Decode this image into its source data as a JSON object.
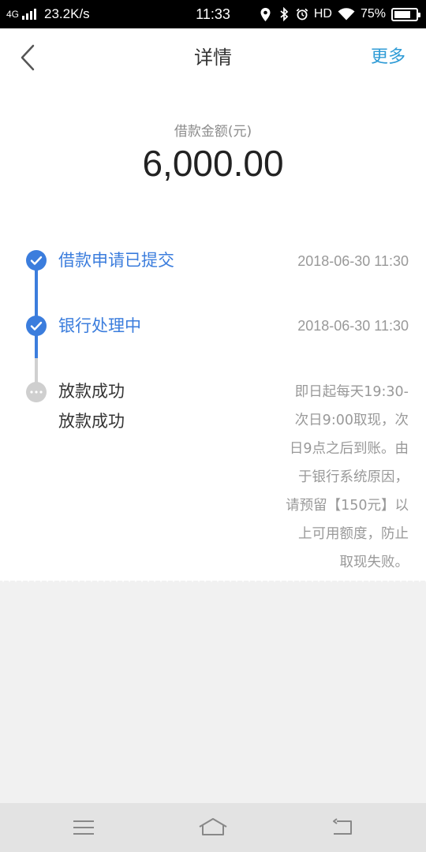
{
  "status_bar": {
    "network": "4G",
    "speed": "23.2K/s",
    "time": "11:33",
    "hd": "HD",
    "battery_percent": "75%",
    "battery_level": 0.75,
    "icons": [
      "location-icon",
      "bluetooth-icon",
      "alarm-icon",
      "wifi-icon",
      "battery-icon"
    ]
  },
  "header": {
    "title": "详情",
    "more_label": "更多",
    "back_icon": "chevron-left-icon"
  },
  "amount": {
    "label": "借款金额(元)",
    "value": "6,000.00"
  },
  "timeline": [
    {
      "title": "借款申请已提交",
      "time": "2018-06-30 11:30",
      "status": "done"
    },
    {
      "title": "银行处理中",
      "time": "2018-06-30 11:30",
      "status": "done"
    },
    {
      "title": "放款成功",
      "subtitle": "放款成功",
      "status": "pending",
      "note_lines": [
        "即日起每天19:30-",
        "次日9:00取现，次",
        "日9点之后到账。由",
        "于银行系统原因，",
        "请预留【150元】以",
        "上可用额度，防止",
        "取现失败。"
      ]
    }
  ],
  "colors": {
    "accent": "#3b7ddd",
    "link": "#2e9bd6",
    "pending": "#cfcfcf",
    "text_muted": "#999999"
  },
  "nav_bar": {
    "icons": [
      "menu-icon",
      "home-icon",
      "back-icon"
    ]
  }
}
